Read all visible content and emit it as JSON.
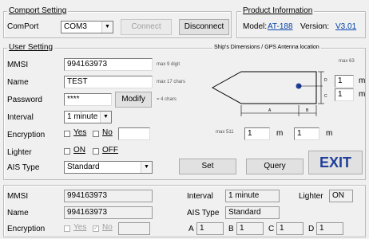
{
  "comport": {
    "legend": "Comport Setting",
    "label": "ComPort",
    "port_value": "COM3",
    "connect_label": "Connect",
    "disconnect_label": "Disconnect"
  },
  "product": {
    "legend": "Product Information",
    "model_label": "Model:",
    "model_value": "AT-188",
    "version_label": "Version:",
    "version_value": "V3.01"
  },
  "user": {
    "legend": "User Setting",
    "mmsi_label": "MMSI",
    "mmsi_value": "994163973",
    "mmsi_hint": "max 9 digit",
    "name_label": "Name",
    "name_value": "TEST",
    "name_hint": "max 17 chars",
    "password_label": "Password",
    "password_value": "****",
    "modify_label": "Modify",
    "password_hint": "= 4 chars",
    "interval_label": "Interval",
    "interval_value": "1 minute",
    "encryption_label": "Encryption",
    "yes_label": "Yes",
    "no_label": "No",
    "encryption_value": "",
    "lighter_label": "Lighter",
    "on_label": "ON",
    "off_label": "OFF",
    "ais_type_label": "AIS Type",
    "ais_type_value": "Standard",
    "set_label": "Set",
    "query_label": "Query",
    "exit_label": "EXIT"
  },
  "ship": {
    "legend": "Ship's Dimensions / GPS Antenna location",
    "max63": "max 63",
    "max511": "max 511",
    "d_value": "1",
    "c_value": "1",
    "a_value": "1",
    "b_value": "1",
    "unit": "m",
    "label_a": "A",
    "label_b": "B",
    "label_c": "C",
    "label_d": "D"
  },
  "status": {
    "mmsi_label": "MMSI",
    "mmsi_value": "994163973",
    "name_label": "Name",
    "name_value": "994163973",
    "encryption_label": "Encryption",
    "yes_label": "Yes",
    "no_label": "No",
    "encryption_value": "",
    "interval_label": "Interval",
    "interval_value": "1 minute",
    "lighter_label": "Lighter",
    "lighter_value": "ON",
    "ais_type_label": "AIS Type",
    "ais_type_value": "Standard",
    "a_label": "A",
    "a_value": "1",
    "b_label": "B",
    "b_value": "1",
    "c_label": "C",
    "c_value": "1",
    "d_label": "D",
    "d_value": "1"
  }
}
